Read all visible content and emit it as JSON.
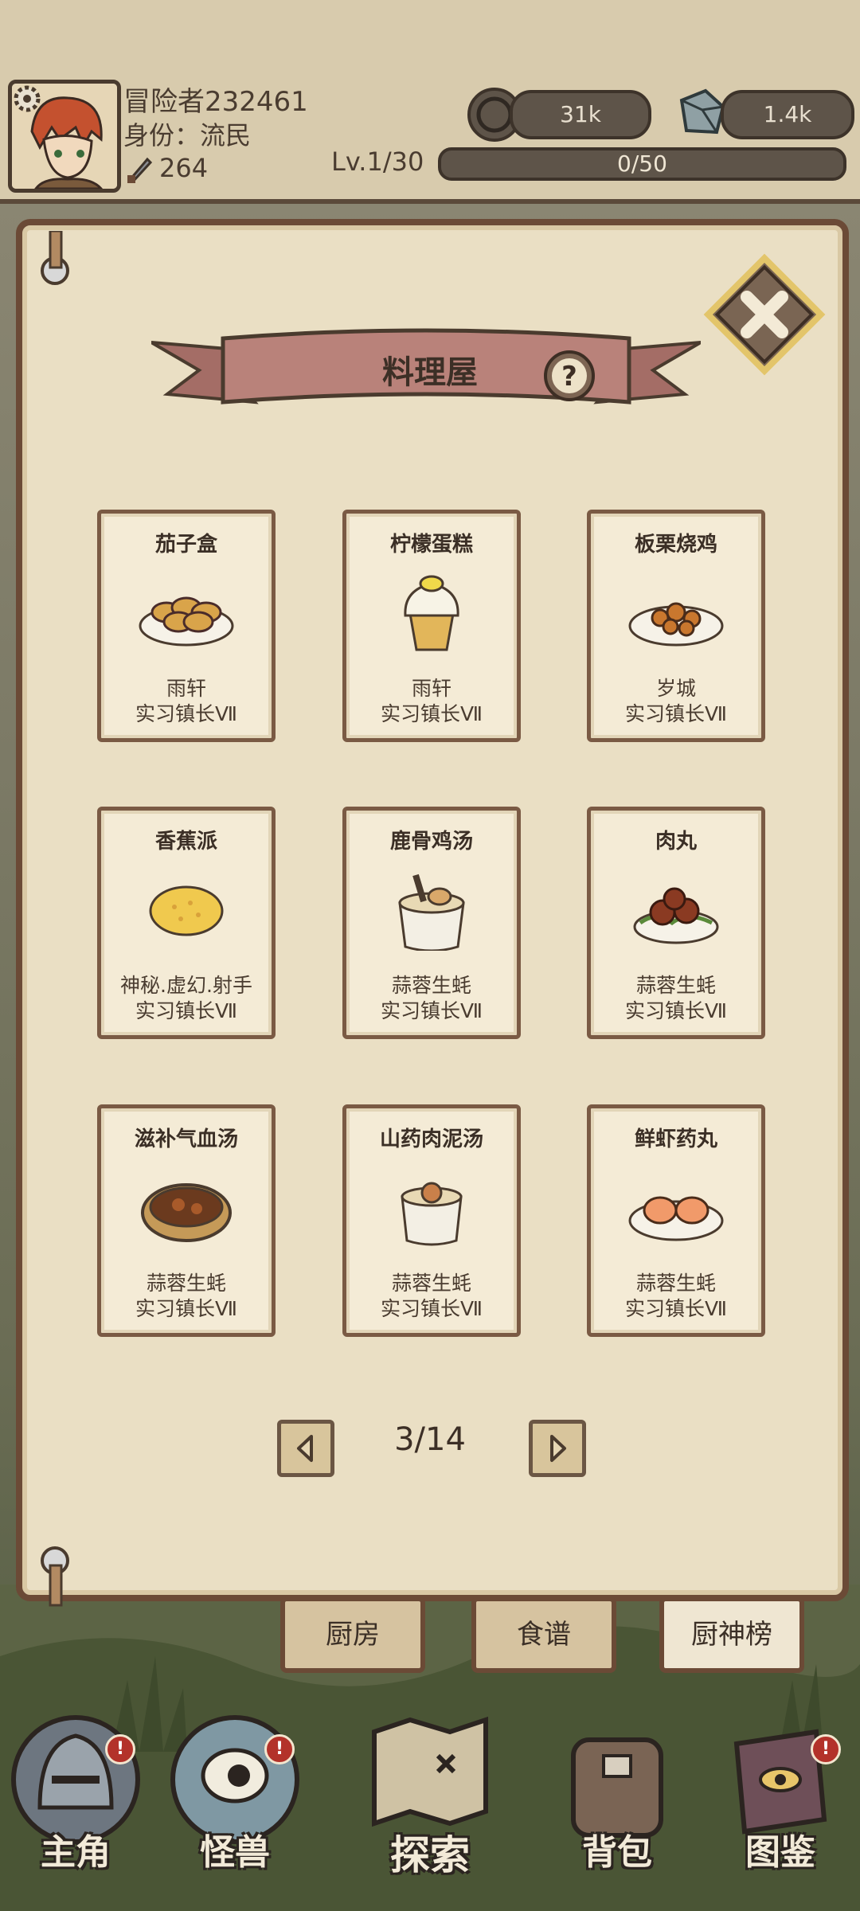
{
  "player": {
    "name": "冒险者232461",
    "identity": "身份：流民",
    "power": "264",
    "level": "Lv.1/30",
    "exp": "0/50",
    "exp_progress": 0
  },
  "currency": {
    "coins": "31k",
    "gems": "1.4k"
  },
  "panel": {
    "title": "料理屋"
  },
  "dishes": [
    {
      "name": "茄子盒",
      "owner": "雨轩",
      "rank": "实习镇长Ⅶ",
      "icon": "eggplant-box-icon"
    },
    {
      "name": "柠檬蛋糕",
      "owner": "雨轩",
      "rank": "实习镇长Ⅶ",
      "icon": "lemon-cake-icon"
    },
    {
      "name": "板栗烧鸡",
      "owner": "岁城",
      "rank": "实习镇长Ⅶ",
      "icon": "chestnut-chicken-icon"
    },
    {
      "name": "香蕉派",
      "owner": "神秘.虚幻.射手",
      "rank": "实习镇长Ⅶ",
      "icon": "banana-pie-icon"
    },
    {
      "name": "鹿骨鸡汤",
      "owner": "蒜蓉生蚝",
      "rank": "实习镇长Ⅶ",
      "icon": "deer-bone-soup-icon"
    },
    {
      "name": "肉丸",
      "owner": "蒜蓉生蚝",
      "rank": "实习镇长Ⅶ",
      "icon": "meatball-icon"
    },
    {
      "name": "滋补气血汤",
      "owner": "蒜蓉生蚝",
      "rank": "实习镇长Ⅶ",
      "icon": "tonic-soup-icon"
    },
    {
      "name": "山药肉泥汤",
      "owner": "蒜蓉生蚝",
      "rank": "实习镇长Ⅶ",
      "icon": "yam-meat-soup-icon"
    },
    {
      "name": "鲜虾药丸",
      "owner": "蒜蓉生蚝",
      "rank": "实习镇长Ⅶ",
      "icon": "shrimp-ball-icon"
    }
  ],
  "pager": {
    "text": "3/14"
  },
  "tabs": [
    {
      "label": "厨房"
    },
    {
      "label": "食谱"
    },
    {
      "label": "厨神榜",
      "active": true
    }
  ],
  "nav": [
    {
      "label": "主角",
      "badge": "!"
    },
    {
      "label": "怪兽",
      "badge": "!"
    },
    {
      "label": "探索"
    },
    {
      "label": "背包"
    },
    {
      "label": "图鉴",
      "badge": "!"
    }
  ],
  "colors": {
    "parchment": "#eadfc4",
    "border": "#6b4a36",
    "ribbon": "#b9827a",
    "badge": "#b3322a"
  }
}
